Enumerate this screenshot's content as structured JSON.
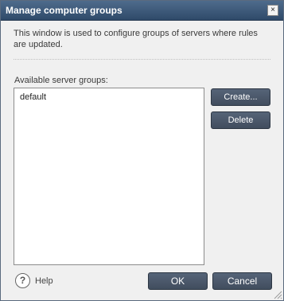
{
  "window": {
    "title": "Manage computer groups",
    "close_symbol": "×"
  },
  "description": "This window is used to configure groups of servers where rules are updated.",
  "server_groups": {
    "label": "Available server groups:",
    "items": [
      "default"
    ]
  },
  "buttons": {
    "create": "Create...",
    "delete": "Delete",
    "ok": "OK",
    "cancel": "Cancel"
  },
  "help": {
    "icon_glyph": "?",
    "label": "Help"
  },
  "colors": {
    "titlebar": "#3d5878",
    "button": "#4b5769",
    "window_bg": "#f0f0f0"
  },
  "icons": [
    "close-icon",
    "help-icon",
    "resize-grip-icon"
  ]
}
